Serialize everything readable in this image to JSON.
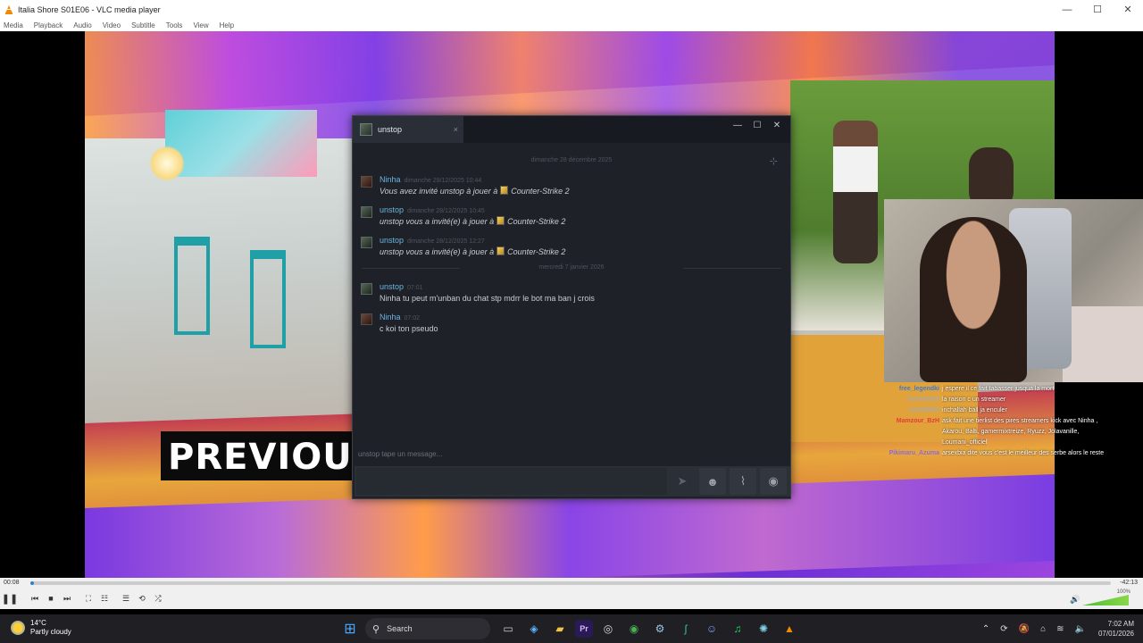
{
  "window": {
    "title": "Italia Shore S01E06 - VLC media player",
    "minimize": "—",
    "maximize": "☐",
    "close": "✕"
  },
  "menu": [
    "Media",
    "Playback",
    "Audio",
    "Video",
    "Subtitle",
    "Tools",
    "View",
    "Help"
  ],
  "video": {
    "overlay_text": "PREVIOUSL"
  },
  "stream_chat": [
    {
      "user": "free_legendki",
      "color": "#3a7bd5",
      "msg": "j espere il ce fait tabasser jusqua la mort"
    },
    {
      "user": "mor000000",
      "color": "#aaaaaa",
      "msg": "la raison c un streamer"
    },
    {
      "user": "mo000000",
      "color": "#aaaaaa",
      "msg": "inchallah ball ja enculer"
    },
    {
      "user": "Mamzour_BzH",
      "color": "#e23b3b",
      "msg": "ask fait une tierlist des pires streamers kick avec Ninha ,"
    },
    {
      "user": "",
      "color": "#ffffff",
      "msg": "Akarou, Balti, gamermixtreize, Ryuzz, Jolavanille,"
    },
    {
      "user": "",
      "color": "#ffffff",
      "msg": "Loumani_officiel"
    },
    {
      "user": "Pikimaru_Azuma",
      "color": "#8a6be0",
      "msg": "arsexbia dite vous c'est le meilleur des serbe alors le reste"
    }
  ],
  "steam_chat": {
    "tab_name": "unstop",
    "tab_close": "×",
    "date1": "dimanche 28 décembre 2025",
    "date2": "mercredi 7 janvier 2026",
    "messages": [
      {
        "user": "Ninha",
        "time": "dimanche 28/12/2025 10:44",
        "pre": "Vous avez invité unstop à jouer à",
        "game": "Counter-Strike 2"
      },
      {
        "user": "unstop",
        "time": "dimanche 28/12/2025 10:45",
        "pre": "unstop vous a invité(e) à jouer à",
        "game": "Counter-Strike 2"
      },
      {
        "user": "unstop",
        "time": "dimanche 28/12/2025 12:27",
        "pre": "unstop vous a invité(e) à jouer à",
        "game": "Counter-Strike 2"
      }
    ],
    "messages2": [
      {
        "user": "unstop",
        "time": "07:01",
        "text": "Ninha tu peut m'unban du chat stp mdrr le bot ma ban j crois"
      },
      {
        "user": "Ninha",
        "time": "07:02",
        "text": "c koi ton pseudo"
      }
    ],
    "typing": "unstop tape un message..."
  },
  "player": {
    "elapsed": "00:08",
    "remaining": "-42:13",
    "progress": 0.003,
    "volume": "100%"
  },
  "taskbar": {
    "temp": "14°C",
    "weather": "Partly cloudy",
    "search": "Search",
    "time": "7:02 AM",
    "date": "07/01/2026"
  }
}
